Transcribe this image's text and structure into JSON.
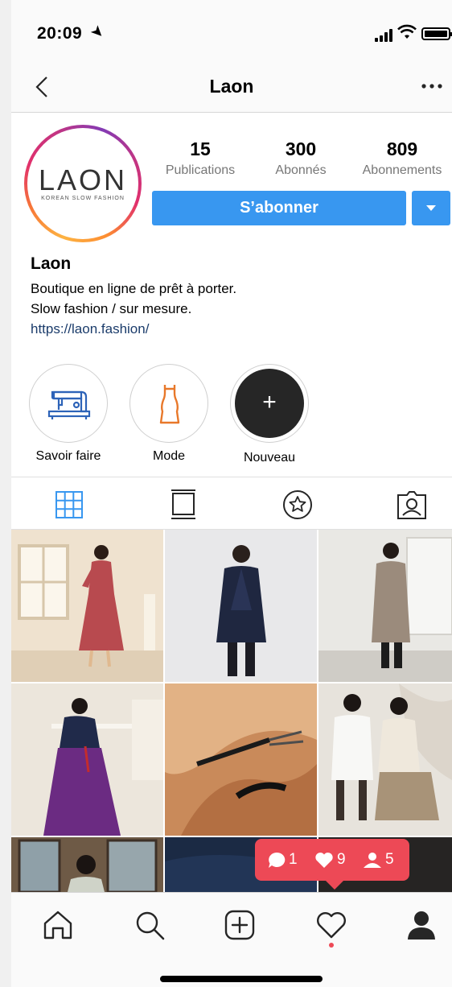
{
  "status_bar": {
    "time": "20:09"
  },
  "nav": {
    "title": "Laon"
  },
  "avatar": {
    "logo_text": "LAON",
    "logo_subtext": "KOREAN SLOW FASHION"
  },
  "stats": [
    {
      "value": "15",
      "label": "Publications"
    },
    {
      "value": "300",
      "label": "Abonnés"
    },
    {
      "value": "809",
      "label": "Abonnements"
    }
  ],
  "follow_button": {
    "label": "S’abonner"
  },
  "bio": {
    "name": "Laon",
    "lines": [
      "Boutique en ligne de prêt à porter.",
      "Slow fashion / sur mesure."
    ],
    "link": "https://laon.fashion/"
  },
  "highlights": [
    {
      "label": "Savoir faire",
      "icon": "sewing-machine-icon"
    },
    {
      "label": "Mode",
      "icon": "dress-icon"
    },
    {
      "label": "Nouveau",
      "icon": "plus-icon"
    }
  ],
  "tabs": [
    {
      "name": "grid-view",
      "icon": "grid-icon",
      "active": true
    },
    {
      "name": "feed-view",
      "icon": "feed-icon",
      "active": false
    },
    {
      "name": "saved",
      "icon": "star-icon",
      "active": false
    },
    {
      "name": "tagged",
      "icon": "tagged-person-icon",
      "active": false
    }
  ],
  "notification": {
    "comments": "1",
    "likes": "9",
    "followers": "5"
  },
  "bottom_tabs": [
    "home-icon",
    "search-icon",
    "add-post-icon",
    "heart-icon",
    "profile-icon"
  ],
  "colors": {
    "accent": "#3897f0",
    "notification": "#ed4956",
    "link": "#1b3c6b"
  }
}
